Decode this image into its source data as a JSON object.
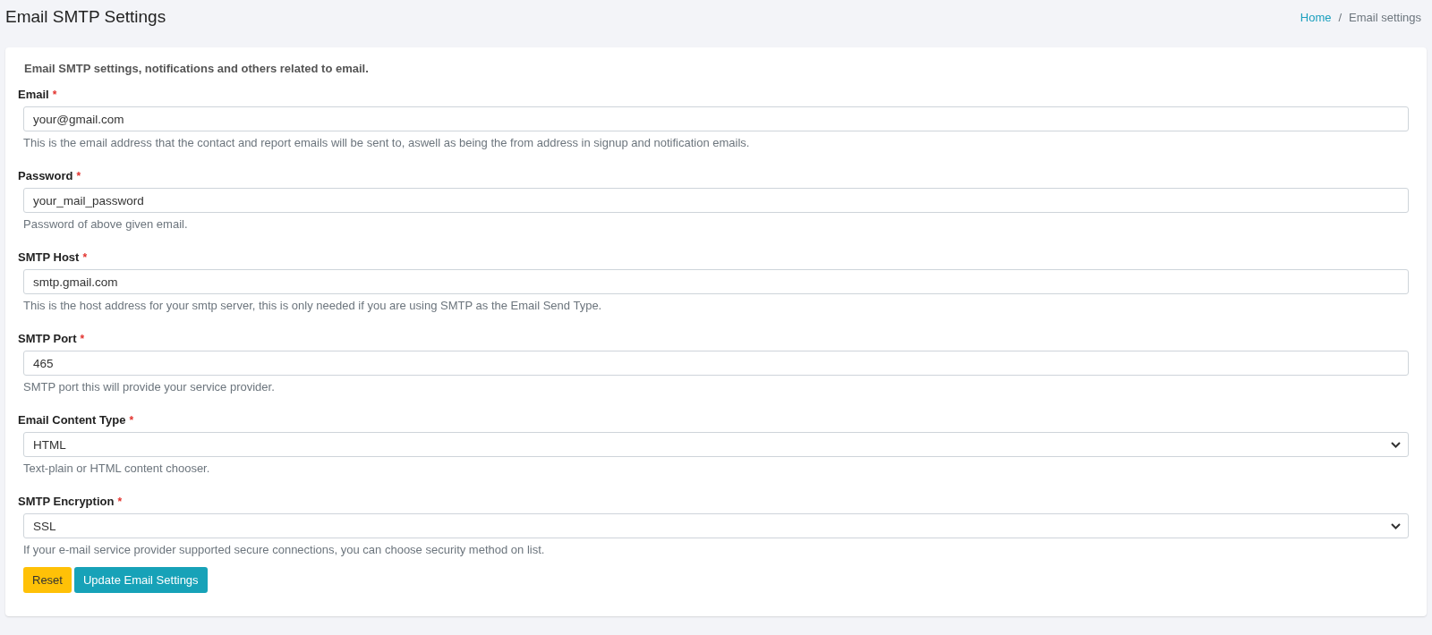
{
  "page_title": "Email SMTP Settings",
  "breadcrumb": [
    {
      "label": "Home",
      "kind": "link"
    },
    {
      "label": "/",
      "kind": "separator"
    },
    {
      "label": "Email settings",
      "kind": "current"
    }
  ],
  "card": {
    "intro": "Email SMTP settings, notifications and others related to email.",
    "fields": [
      {
        "label": "Email",
        "required_mark": "*",
        "kind": "input",
        "value": "your@gmail.com",
        "help": "This is the email address that the contact and report emails will be sent to, aswell as being the from address in signup and notification emails."
      },
      {
        "label": "Password",
        "required_mark": "*",
        "kind": "input",
        "value": "your_mail_password",
        "help": "Password of above given email."
      },
      {
        "label": "SMTP Host",
        "required_mark": "*",
        "kind": "input",
        "value": "smtp.gmail.com",
        "help": "This is the host address for your smtp server, this is only needed if you are using SMTP as the Email Send Type."
      },
      {
        "label": "SMTP Port",
        "required_mark": "*",
        "kind": "input",
        "value": "465",
        "help": "SMTP port this will provide your service provider."
      },
      {
        "label": "Email Content Type",
        "required_mark": "*",
        "kind": "select",
        "value": "HTML",
        "help": "Text-plain or HTML content chooser."
      },
      {
        "label": "SMTP Encryption",
        "required_mark": "*",
        "kind": "select",
        "value": "SSL",
        "help": "If your e-mail service provider supported secure connections, you can choose security method on list."
      }
    ],
    "buttons": [
      {
        "label": "Reset",
        "kind": "warning"
      },
      {
        "label": "Update Email Settings",
        "kind": "primary"
      }
    ]
  }
}
